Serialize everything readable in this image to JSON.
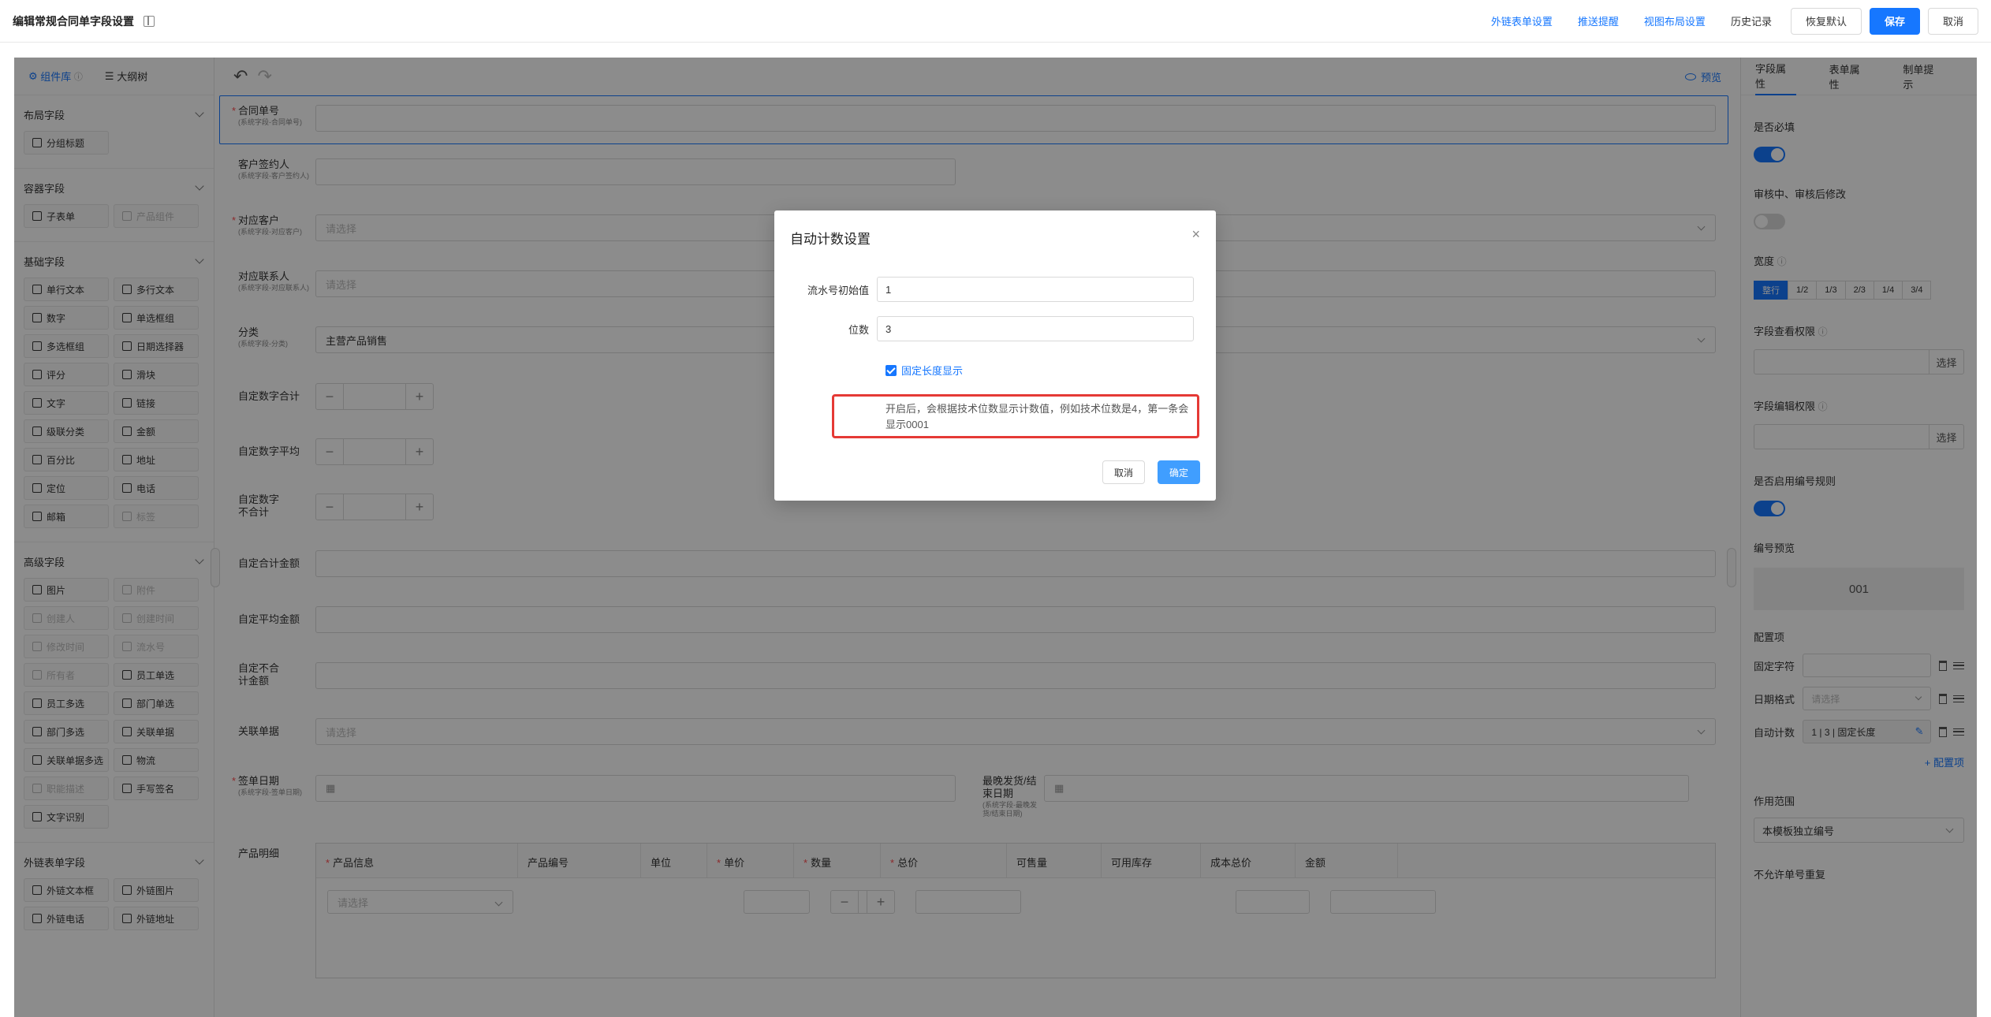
{
  "header": {
    "title": "编辑常规合同单字段设置",
    "links": [
      "外链表单设置",
      "推送提醒",
      "视图布局设置"
    ],
    "history": "历史记录",
    "restore": "恢复默认",
    "save": "保存",
    "cancel": "取消"
  },
  "left": {
    "tabs": [
      "组件库",
      "大纲树"
    ],
    "groups": [
      {
        "title": "布局字段",
        "items": [
          {
            "label": "分组标题",
            "disabled": false
          }
        ]
      },
      {
        "title": "容器字段",
        "items": [
          {
            "label": "子表单",
            "disabled": false
          },
          {
            "label": "产品组件",
            "disabled": true
          }
        ]
      },
      {
        "title": "基础字段",
        "items": [
          {
            "label": "单行文本"
          },
          {
            "label": "多行文本"
          },
          {
            "label": "数字"
          },
          {
            "label": "单选框组"
          },
          {
            "label": "多选框组"
          },
          {
            "label": "日期选择器"
          },
          {
            "label": "评分"
          },
          {
            "label": "滑块"
          },
          {
            "label": "文字"
          },
          {
            "label": "链接"
          },
          {
            "label": "级联分类"
          },
          {
            "label": "金额"
          },
          {
            "label": "百分比"
          },
          {
            "label": "地址"
          },
          {
            "label": "定位"
          },
          {
            "label": "电话"
          },
          {
            "label": "邮箱"
          },
          {
            "label": "标签",
            "disabled": true
          }
        ]
      },
      {
        "title": "高级字段",
        "items": [
          {
            "label": "图片"
          },
          {
            "label": "附件",
            "disabled": true
          },
          {
            "label": "创建人",
            "disabled": true
          },
          {
            "label": "创建时间",
            "disabled": true
          },
          {
            "label": "修改时间",
            "disabled": true
          },
          {
            "label": "流水号",
            "disabled": true
          },
          {
            "label": "所有者",
            "disabled": true
          },
          {
            "label": "员工单选"
          },
          {
            "label": "员工多选"
          },
          {
            "label": "部门单选"
          },
          {
            "label": "部门多选"
          },
          {
            "label": "关联单据"
          },
          {
            "label": "关联单据多选"
          },
          {
            "label": "物流"
          },
          {
            "label": "职能描述",
            "disabled": true
          },
          {
            "label": "手写签名"
          },
          {
            "label": "文字识别"
          }
        ]
      },
      {
        "title": "外链表单字段",
        "items": [
          {
            "label": "外链文本框"
          },
          {
            "label": "外链图片"
          },
          {
            "label": "外链电话"
          },
          {
            "label": "外链地址"
          }
        ]
      }
    ]
  },
  "canvas": {
    "preview": "预览",
    "fields": {
      "contract_no": {
        "label": "合同单号",
        "sub": "(系统字段-合同单号)"
      },
      "signer": {
        "label": "客户签约人",
        "sub": "(系统字段-客户签约人)"
      },
      "customer": {
        "label": "对应客户",
        "sub": "(系统字段-对应客户)",
        "placeholder": "请选择"
      },
      "contact": {
        "label": "对应联系人",
        "sub": "(系统字段-对应联系人)",
        "placeholder": "请选择"
      },
      "category": {
        "label": "分类",
        "sub": "(系统字段-分类)",
        "value": "主营产品销售"
      },
      "sum": {
        "label": "自定数字合计"
      },
      "avg": {
        "label": "自定数字平均"
      },
      "nosum": {
        "label": "自定数字不合计"
      },
      "amount_sum": {
        "label": "自定合计金额"
      },
      "amount_avg": {
        "label": "自定平均金额"
      },
      "amount_nosum": {
        "label": "自定不合计金额"
      },
      "related": {
        "label": "关联单据",
        "placeholder": "请选择"
      },
      "sign_date": {
        "label": "签单日期",
        "sub": "(系统字段-签单日期)"
      },
      "latest_date": {
        "label": "最晚发货/结束日期",
        "sub": "(系统字段-最晚发货/结束日期)"
      },
      "products": {
        "label": "产品明细"
      }
    },
    "product_cols": [
      "产品信息",
      "产品编号",
      "单位",
      "单价",
      "数量",
      "总价",
      "可售量",
      "可用库存",
      "成本总价",
      "金额"
    ],
    "product_placeholder": "请选择"
  },
  "right": {
    "tabs": [
      "字段属性",
      "表单属性",
      "制单提示"
    ],
    "required": "是否必填",
    "editable": "审核中、审核后修改",
    "width": "宽度",
    "width_options": [
      "整行",
      "1/2",
      "1/3",
      "2/3",
      "1/4",
      "3/4"
    ],
    "view_perm": "字段查看权限",
    "edit_perm": "字段编辑权限",
    "choose": "选择",
    "rule": "是否启用编号规则",
    "preview_label": "编号预览",
    "preview_value": "001",
    "config": "配置项",
    "fixed_char": "固定字符",
    "date_format": "日期格式",
    "date_placeholder": "请选择",
    "auto_count": "自动计数",
    "auto_count_value": "1 | 3 | 固定长度",
    "add_config": "+ 配置项",
    "scope": "作用范围",
    "scope_value": "本模板独立编号",
    "no_dup": "不允许单号重复"
  },
  "modal": {
    "title": "自动计数设置",
    "start_label": "流水号初始值",
    "start_value": "1",
    "digits_label": "位数",
    "digits_value": "3",
    "fixed_length": "固定长度显示",
    "note": "开启后，会根据技术位数显示计数值，例如技术位数是4，第一条会显示0001",
    "cancel": "取消",
    "ok": "确定"
  }
}
